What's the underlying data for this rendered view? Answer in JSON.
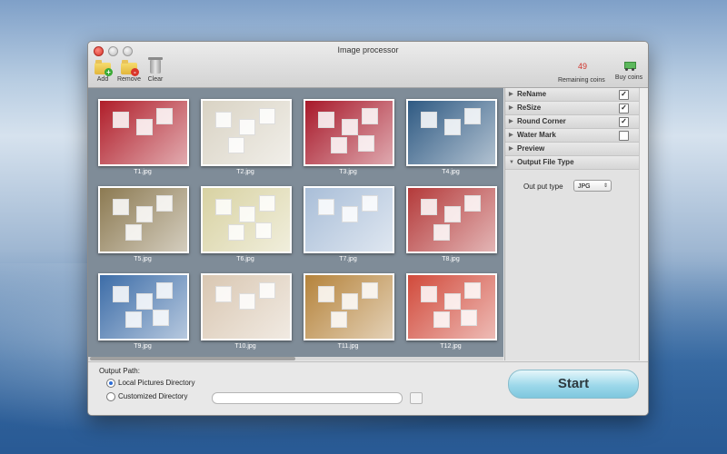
{
  "window": {
    "title": "Image processor"
  },
  "toolbar": {
    "add_label": "Add",
    "remove_label": "Remove",
    "clear_label": "Clear",
    "coins_count": "49",
    "coins_label": "Remaining coins",
    "buy_label": "Buy coins"
  },
  "gallery": {
    "items": [
      {
        "name": "T1.jpg",
        "bg": "#b01e2a"
      },
      {
        "name": "T2.jpg",
        "bg": "#d9d3c4"
      },
      {
        "name": "T3.jpg",
        "bg": "#a8192a"
      },
      {
        "name": "T4.jpg",
        "bg": "#2f5a83"
      },
      {
        "name": "T5.jpg",
        "bg": "#8c7a52"
      },
      {
        "name": "T6.jpg",
        "bg": "#d8d2a2"
      },
      {
        "name": "T7.jpg",
        "bg": "#a9bed8"
      },
      {
        "name": "T8.jpg",
        "bg": "#b43a3a"
      },
      {
        "name": "T9.jpg",
        "bg": "#3d6da8"
      },
      {
        "name": "T10.jpg",
        "bg": "#d9c7b2"
      },
      {
        "name": "T11.jpg",
        "bg": "#b5833b"
      },
      {
        "name": "T12.jpg",
        "bg": "#d14a3b"
      }
    ]
  },
  "panel": {
    "sections": [
      {
        "label": "ReName",
        "checked": true,
        "checkbox": true,
        "expanded": false
      },
      {
        "label": "ReSize",
        "checked": true,
        "checkbox": true,
        "expanded": false
      },
      {
        "label": "Round Corner",
        "checked": true,
        "checkbox": true,
        "expanded": false
      },
      {
        "label": "Water Mark",
        "checked": false,
        "checkbox": true,
        "expanded": false
      },
      {
        "label": "Preview",
        "checked": false,
        "checkbox": false,
        "expanded": false
      },
      {
        "label": "Output File Type",
        "checked": false,
        "checkbox": false,
        "expanded": true
      }
    ],
    "output_type_label": "Out put type",
    "output_type_value": "JPG"
  },
  "bottom": {
    "output_path_label": "Output Path:",
    "option_local": "Local Pictures Directory",
    "option_custom": "Customized Directory",
    "start_label": "Start"
  }
}
